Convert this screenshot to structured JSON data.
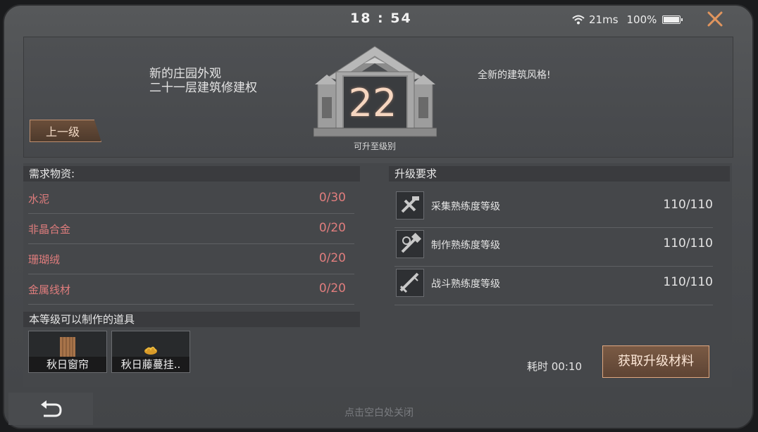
{
  "status": {
    "time": "18 : 54",
    "ping": "21ms",
    "battery": "100%"
  },
  "header": {
    "new_appearance_line1": "新的庄园外观",
    "new_appearance_line2": "二十一层建筑修建权",
    "new_style": "全新的建筑风格!",
    "prev_level_label": "上一级",
    "level": "22",
    "upgrade_label": "可升至级别"
  },
  "requirements": {
    "title": "需求物资:",
    "items": [
      {
        "name": "水泥",
        "count": "0/30"
      },
      {
        "name": "非晶合金",
        "count": "0/20"
      },
      {
        "name": "珊瑚绒",
        "count": "0/20"
      },
      {
        "name": "金属线材",
        "count": "0/20"
      }
    ]
  },
  "conditions": {
    "title": "升级要求",
    "items": [
      {
        "name": "采集熟练度等级",
        "value": "110/110",
        "icon": "gather-icon"
      },
      {
        "name": "制作熟练度等级",
        "value": "110/110",
        "icon": "craft-icon"
      },
      {
        "name": "战斗熟练度等级",
        "value": "110/110",
        "icon": "combat-icon"
      }
    ]
  },
  "craftable": {
    "title": "本等级可以制作的道具",
    "items": [
      {
        "label": "秋日窗帘"
      },
      {
        "label": "秋日藤蔓挂.."
      }
    ]
  },
  "footer": {
    "time_cost": "耗时 00:10",
    "get_materials": "获取升级材料",
    "close_hint": "点击空白处关闭"
  },
  "colors": {
    "accent": "#e0a880",
    "missing": "#e07d7d"
  }
}
